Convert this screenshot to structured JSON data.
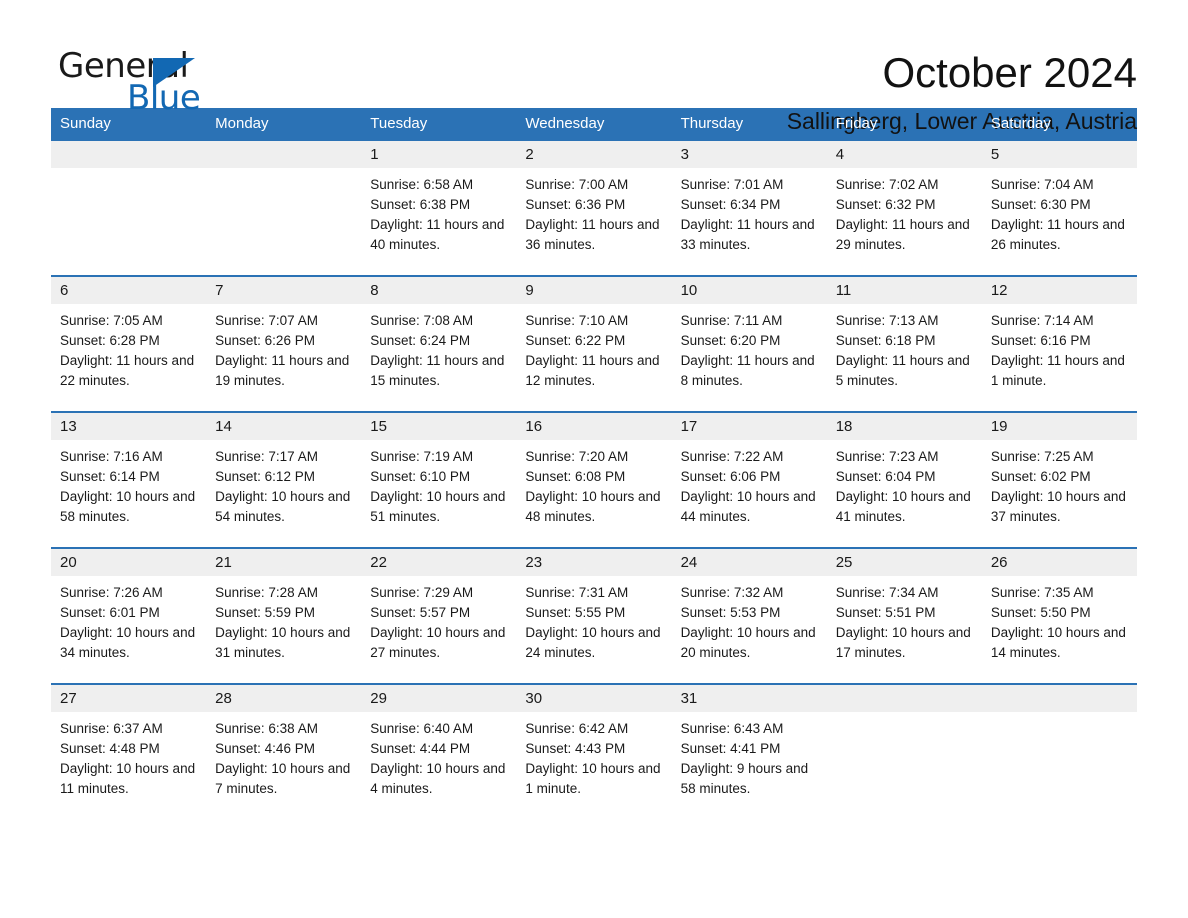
{
  "brand": {
    "name_part1": "General",
    "name_part2": "Blue",
    "triangle_color": "#1268b3"
  },
  "header": {
    "title": "October 2024",
    "location": "Sallingberg, Lower Austria, Austria"
  },
  "calendar": {
    "header_color": "#2b72b5",
    "weekdays": [
      "Sunday",
      "Monday",
      "Tuesday",
      "Wednesday",
      "Thursday",
      "Friday",
      "Saturday"
    ],
    "weeks": [
      {
        "days": [
          {
            "num": "",
            "sunrise": "",
            "sunset": "",
            "daylight": ""
          },
          {
            "num": "",
            "sunrise": "",
            "sunset": "",
            "daylight": ""
          },
          {
            "num": "1",
            "sunrise": "Sunrise: 6:58 AM",
            "sunset": "Sunset: 6:38 PM",
            "daylight": "Daylight: 11 hours and 40 minutes."
          },
          {
            "num": "2",
            "sunrise": "Sunrise: 7:00 AM",
            "sunset": "Sunset: 6:36 PM",
            "daylight": "Daylight: 11 hours and 36 minutes."
          },
          {
            "num": "3",
            "sunrise": "Sunrise: 7:01 AM",
            "sunset": "Sunset: 6:34 PM",
            "daylight": "Daylight: 11 hours and 33 minutes."
          },
          {
            "num": "4",
            "sunrise": "Sunrise: 7:02 AM",
            "sunset": "Sunset: 6:32 PM",
            "daylight": "Daylight: 11 hours and 29 minutes."
          },
          {
            "num": "5",
            "sunrise": "Sunrise: 7:04 AM",
            "sunset": "Sunset: 6:30 PM",
            "daylight": "Daylight: 11 hours and 26 minutes."
          }
        ]
      },
      {
        "days": [
          {
            "num": "6",
            "sunrise": "Sunrise: 7:05 AM",
            "sunset": "Sunset: 6:28 PM",
            "daylight": "Daylight: 11 hours and 22 minutes."
          },
          {
            "num": "7",
            "sunrise": "Sunrise: 7:07 AM",
            "sunset": "Sunset: 6:26 PM",
            "daylight": "Daylight: 11 hours and 19 minutes."
          },
          {
            "num": "8",
            "sunrise": "Sunrise: 7:08 AM",
            "sunset": "Sunset: 6:24 PM",
            "daylight": "Daylight: 11 hours and 15 minutes."
          },
          {
            "num": "9",
            "sunrise": "Sunrise: 7:10 AM",
            "sunset": "Sunset: 6:22 PM",
            "daylight": "Daylight: 11 hours and 12 minutes."
          },
          {
            "num": "10",
            "sunrise": "Sunrise: 7:11 AM",
            "sunset": "Sunset: 6:20 PM",
            "daylight": "Daylight: 11 hours and 8 minutes."
          },
          {
            "num": "11",
            "sunrise": "Sunrise: 7:13 AM",
            "sunset": "Sunset: 6:18 PM",
            "daylight": "Daylight: 11 hours and 5 minutes."
          },
          {
            "num": "12",
            "sunrise": "Sunrise: 7:14 AM",
            "sunset": "Sunset: 6:16 PM",
            "daylight": "Daylight: 11 hours and 1 minute."
          }
        ]
      },
      {
        "days": [
          {
            "num": "13",
            "sunrise": "Sunrise: 7:16 AM",
            "sunset": "Sunset: 6:14 PM",
            "daylight": "Daylight: 10 hours and 58 minutes."
          },
          {
            "num": "14",
            "sunrise": "Sunrise: 7:17 AM",
            "sunset": "Sunset: 6:12 PM",
            "daylight": "Daylight: 10 hours and 54 minutes."
          },
          {
            "num": "15",
            "sunrise": "Sunrise: 7:19 AM",
            "sunset": "Sunset: 6:10 PM",
            "daylight": "Daylight: 10 hours and 51 minutes."
          },
          {
            "num": "16",
            "sunrise": "Sunrise: 7:20 AM",
            "sunset": "Sunset: 6:08 PM",
            "daylight": "Daylight: 10 hours and 48 minutes."
          },
          {
            "num": "17",
            "sunrise": "Sunrise: 7:22 AM",
            "sunset": "Sunset: 6:06 PM",
            "daylight": "Daylight: 10 hours and 44 minutes."
          },
          {
            "num": "18",
            "sunrise": "Sunrise: 7:23 AM",
            "sunset": "Sunset: 6:04 PM",
            "daylight": "Daylight: 10 hours and 41 minutes."
          },
          {
            "num": "19",
            "sunrise": "Sunrise: 7:25 AM",
            "sunset": "Sunset: 6:02 PM",
            "daylight": "Daylight: 10 hours and 37 minutes."
          }
        ]
      },
      {
        "days": [
          {
            "num": "20",
            "sunrise": "Sunrise: 7:26 AM",
            "sunset": "Sunset: 6:01 PM",
            "daylight": "Daylight: 10 hours and 34 minutes."
          },
          {
            "num": "21",
            "sunrise": "Sunrise: 7:28 AM",
            "sunset": "Sunset: 5:59 PM",
            "daylight": "Daylight: 10 hours and 31 minutes."
          },
          {
            "num": "22",
            "sunrise": "Sunrise: 7:29 AM",
            "sunset": "Sunset: 5:57 PM",
            "daylight": "Daylight: 10 hours and 27 minutes."
          },
          {
            "num": "23",
            "sunrise": "Sunrise: 7:31 AM",
            "sunset": "Sunset: 5:55 PM",
            "daylight": "Daylight: 10 hours and 24 minutes."
          },
          {
            "num": "24",
            "sunrise": "Sunrise: 7:32 AM",
            "sunset": "Sunset: 5:53 PM",
            "daylight": "Daylight: 10 hours and 20 minutes."
          },
          {
            "num": "25",
            "sunrise": "Sunrise: 7:34 AM",
            "sunset": "Sunset: 5:51 PM",
            "daylight": "Daylight: 10 hours and 17 minutes."
          },
          {
            "num": "26",
            "sunrise": "Sunrise: 7:35 AM",
            "sunset": "Sunset: 5:50 PM",
            "daylight": "Daylight: 10 hours and 14 minutes."
          }
        ]
      },
      {
        "days": [
          {
            "num": "27",
            "sunrise": "Sunrise: 6:37 AM",
            "sunset": "Sunset: 4:48 PM",
            "daylight": "Daylight: 10 hours and 11 minutes."
          },
          {
            "num": "28",
            "sunrise": "Sunrise: 6:38 AM",
            "sunset": "Sunset: 4:46 PM",
            "daylight": "Daylight: 10 hours and 7 minutes."
          },
          {
            "num": "29",
            "sunrise": "Sunrise: 6:40 AM",
            "sunset": "Sunset: 4:44 PM",
            "daylight": "Daylight: 10 hours and 4 minutes."
          },
          {
            "num": "30",
            "sunrise": "Sunrise: 6:42 AM",
            "sunset": "Sunset: 4:43 PM",
            "daylight": "Daylight: 10 hours and 1 minute."
          },
          {
            "num": "31",
            "sunrise": "Sunrise: 6:43 AM",
            "sunset": "Sunset: 4:41 PM",
            "daylight": "Daylight: 9 hours and 58 minutes."
          },
          {
            "num": "",
            "sunrise": "",
            "sunset": "",
            "daylight": ""
          },
          {
            "num": "",
            "sunrise": "",
            "sunset": "",
            "daylight": ""
          }
        ]
      }
    ]
  }
}
